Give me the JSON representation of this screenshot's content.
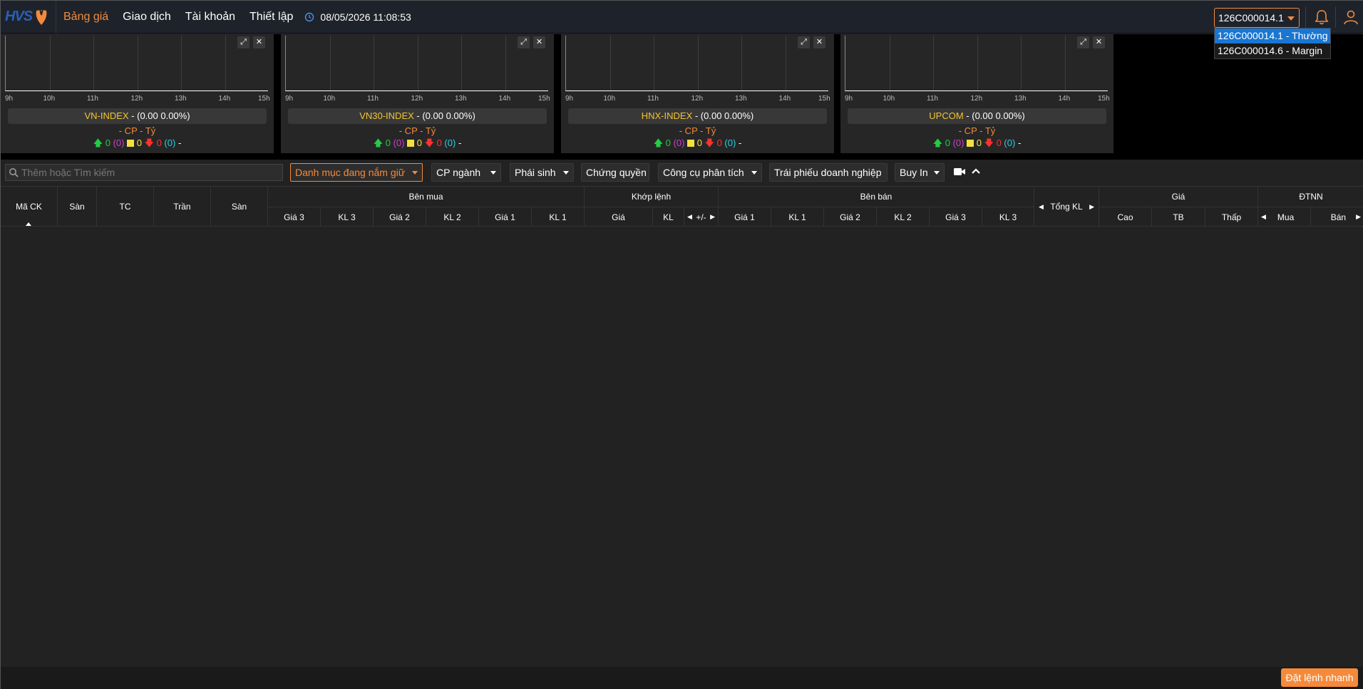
{
  "nav": {
    "logo": "HVS",
    "items": [
      "Bảng giá",
      "Giao dịch",
      "Tài khoản",
      "Thiết lập"
    ],
    "datetime": "08/05/2026 11:08:53",
    "account_selected": "126C000014.1",
    "account_options": [
      "126C000014.1 - Thường",
      "126C000014.6 - Margin"
    ]
  },
  "indices": [
    {
      "name": "VN-INDEX",
      "change": " - (0.00 0.00%)",
      "cp_line": "- CP - Tỷ",
      "up": "0",
      "ceil": "(0)",
      "ref": "0",
      "down": "0",
      "floor": "(0)",
      "dash": "-"
    },
    {
      "name": "VN30-INDEX",
      "change": " - (0.00 0.00%)",
      "cp_line": "- CP - Tỷ",
      "up": "0",
      "ceil": "(0)",
      "ref": "0",
      "down": "0",
      "floor": "(0)",
      "dash": "-"
    },
    {
      "name": "HNX-INDEX",
      "change": " - (0.00 0.00%)",
      "cp_line": "- CP - Tỷ",
      "up": "0",
      "ceil": "(0)",
      "ref": "0",
      "down": "0",
      "floor": "(0)",
      "dash": "-"
    },
    {
      "name": "UPCOM",
      "change": " - (0.00 0.00%)",
      "cp_line": "- CP - Tỷ",
      "up": "0",
      "ceil": "(0)",
      "ref": "0",
      "down": "0",
      "floor": "(0)",
      "dash": "-"
    }
  ],
  "time_ticks": [
    "9h",
    "10h",
    "11h",
    "12h",
    "13h",
    "14h",
    "15h"
  ],
  "toolbar": {
    "search_placeholder": "Thêm hoặc Tìm kiếm",
    "portfolio": "Danh mục đang nắm giữ",
    "sector": "CP ngành",
    "derivatives": "Phái sinh",
    "warrants": "Chứng quyền",
    "analysis": "Công cụ phân tích",
    "bonds": "Trái phiếu doanh nghiệp",
    "buyin": "Buy In"
  },
  "table": {
    "ma_ck": "Mã CK",
    "san": "Sàn",
    "tc": "TC",
    "tran": "Trần",
    "san2": "Sàn",
    "ben_mua": "Bên mua",
    "buy_cols": [
      "Giá 3",
      "KL 3",
      "Giá 2",
      "KL 2",
      "Giá 1",
      "KL 1"
    ],
    "khop_lenh": "Khớp lệnh",
    "match_cols": [
      "Giá",
      "KL",
      "+/-"
    ],
    "ben_ban": "Bên bán",
    "sell_cols": [
      "Giá 1",
      "KL 1",
      "Giá 2",
      "KL 2",
      "Giá 3",
      "KL 3"
    ],
    "tong_kl": "Tổng KL",
    "gia": "Giá",
    "price_cols": [
      "Cao",
      "TB",
      "Thấp"
    ],
    "dtnn": "ĐTNN",
    "foreign_cols": [
      "Mua",
      "Bán"
    ]
  },
  "footer": {
    "quick_order": "Đặt lệnh nhanh"
  }
}
